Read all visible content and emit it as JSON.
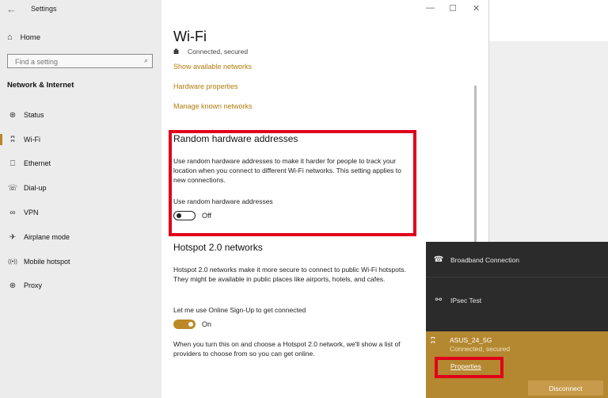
{
  "window": {
    "title": "Settings",
    "back": "←",
    "minimize": "—",
    "maximize": "☐",
    "close": "✕"
  },
  "sidebar": {
    "home_icon": "⌂",
    "home_label": "Home",
    "search_placeholder": "Find a setting",
    "search_icon": "⌕",
    "section_heading": "Network & Internet",
    "items": [
      {
        "label": "Status",
        "icon": "⊕",
        "icon_name": "globe-icon",
        "selected": false
      },
      {
        "label": "Wi-Fi",
        "icon": "ʭ",
        "icon_name": "wifi-icon",
        "selected": true
      },
      {
        "label": "Ethernet",
        "icon": "⎕",
        "icon_name": "ethernet-icon",
        "selected": false
      },
      {
        "label": "Dial-up",
        "icon": "☏",
        "icon_name": "dialup-icon",
        "selected": false
      },
      {
        "label": "VPN",
        "icon": "∞",
        "icon_name": "vpn-icon",
        "selected": false
      },
      {
        "label": "Airplane mode",
        "icon": "✈",
        "icon_name": "airplane-icon",
        "selected": false
      },
      {
        "label": "Mobile hotspot",
        "icon": "((•))",
        "icon_name": "hotspot-icon",
        "selected": false
      },
      {
        "label": "Proxy",
        "icon": "⊕",
        "icon_name": "proxy-globe-icon",
        "selected": false
      }
    ]
  },
  "main": {
    "title": "Wi-Fi",
    "status_icon": "ıllı",
    "status_text": "Connected, secured",
    "links": [
      "Show available networks",
      "Hardware properties",
      "Manage known networks"
    ],
    "random_hw": {
      "title": "Random hardware addresses",
      "description": "Use random hardware addresses to make it harder for people to track your location when you connect to different Wi-Fi networks. This setting applies to new connections.",
      "toggle_label": "Use random hardware addresses",
      "toggle_on": false,
      "toggle_state": "Off"
    },
    "hotspot": {
      "title": "Hotspot 2.0 networks",
      "description": "Hotspot 2.0 networks make it more secure to connect to public Wi-Fi hotspots. They might be available in public places like airports, hotels, and cafes.",
      "toggle_label": "Let me use Online Sign-Up to get connected",
      "toggle_on": true,
      "toggle_state": "On",
      "note": "When you turn this on and choose a Hotspot 2.0 network, we'll show a list of providers to choose from so you can get online."
    }
  },
  "flyout": {
    "networks": [
      {
        "name": "Broadband Connection",
        "icon": "☎"
      },
      {
        "name": "IPsec Test",
        "icon": "⚯"
      }
    ],
    "active": {
      "name": "ASUS_24_5G",
      "status": "Connected, secured",
      "icon": "ʭ",
      "properties_label": "Properties",
      "disconnect_label": "Disconnect"
    }
  },
  "colors": {
    "accent": "#b17b0c",
    "highlight": "#e1001a",
    "toggle_on": "#bc8927",
    "flyout_bg": "#2b2b2b",
    "flyout_active": "#b48830"
  }
}
